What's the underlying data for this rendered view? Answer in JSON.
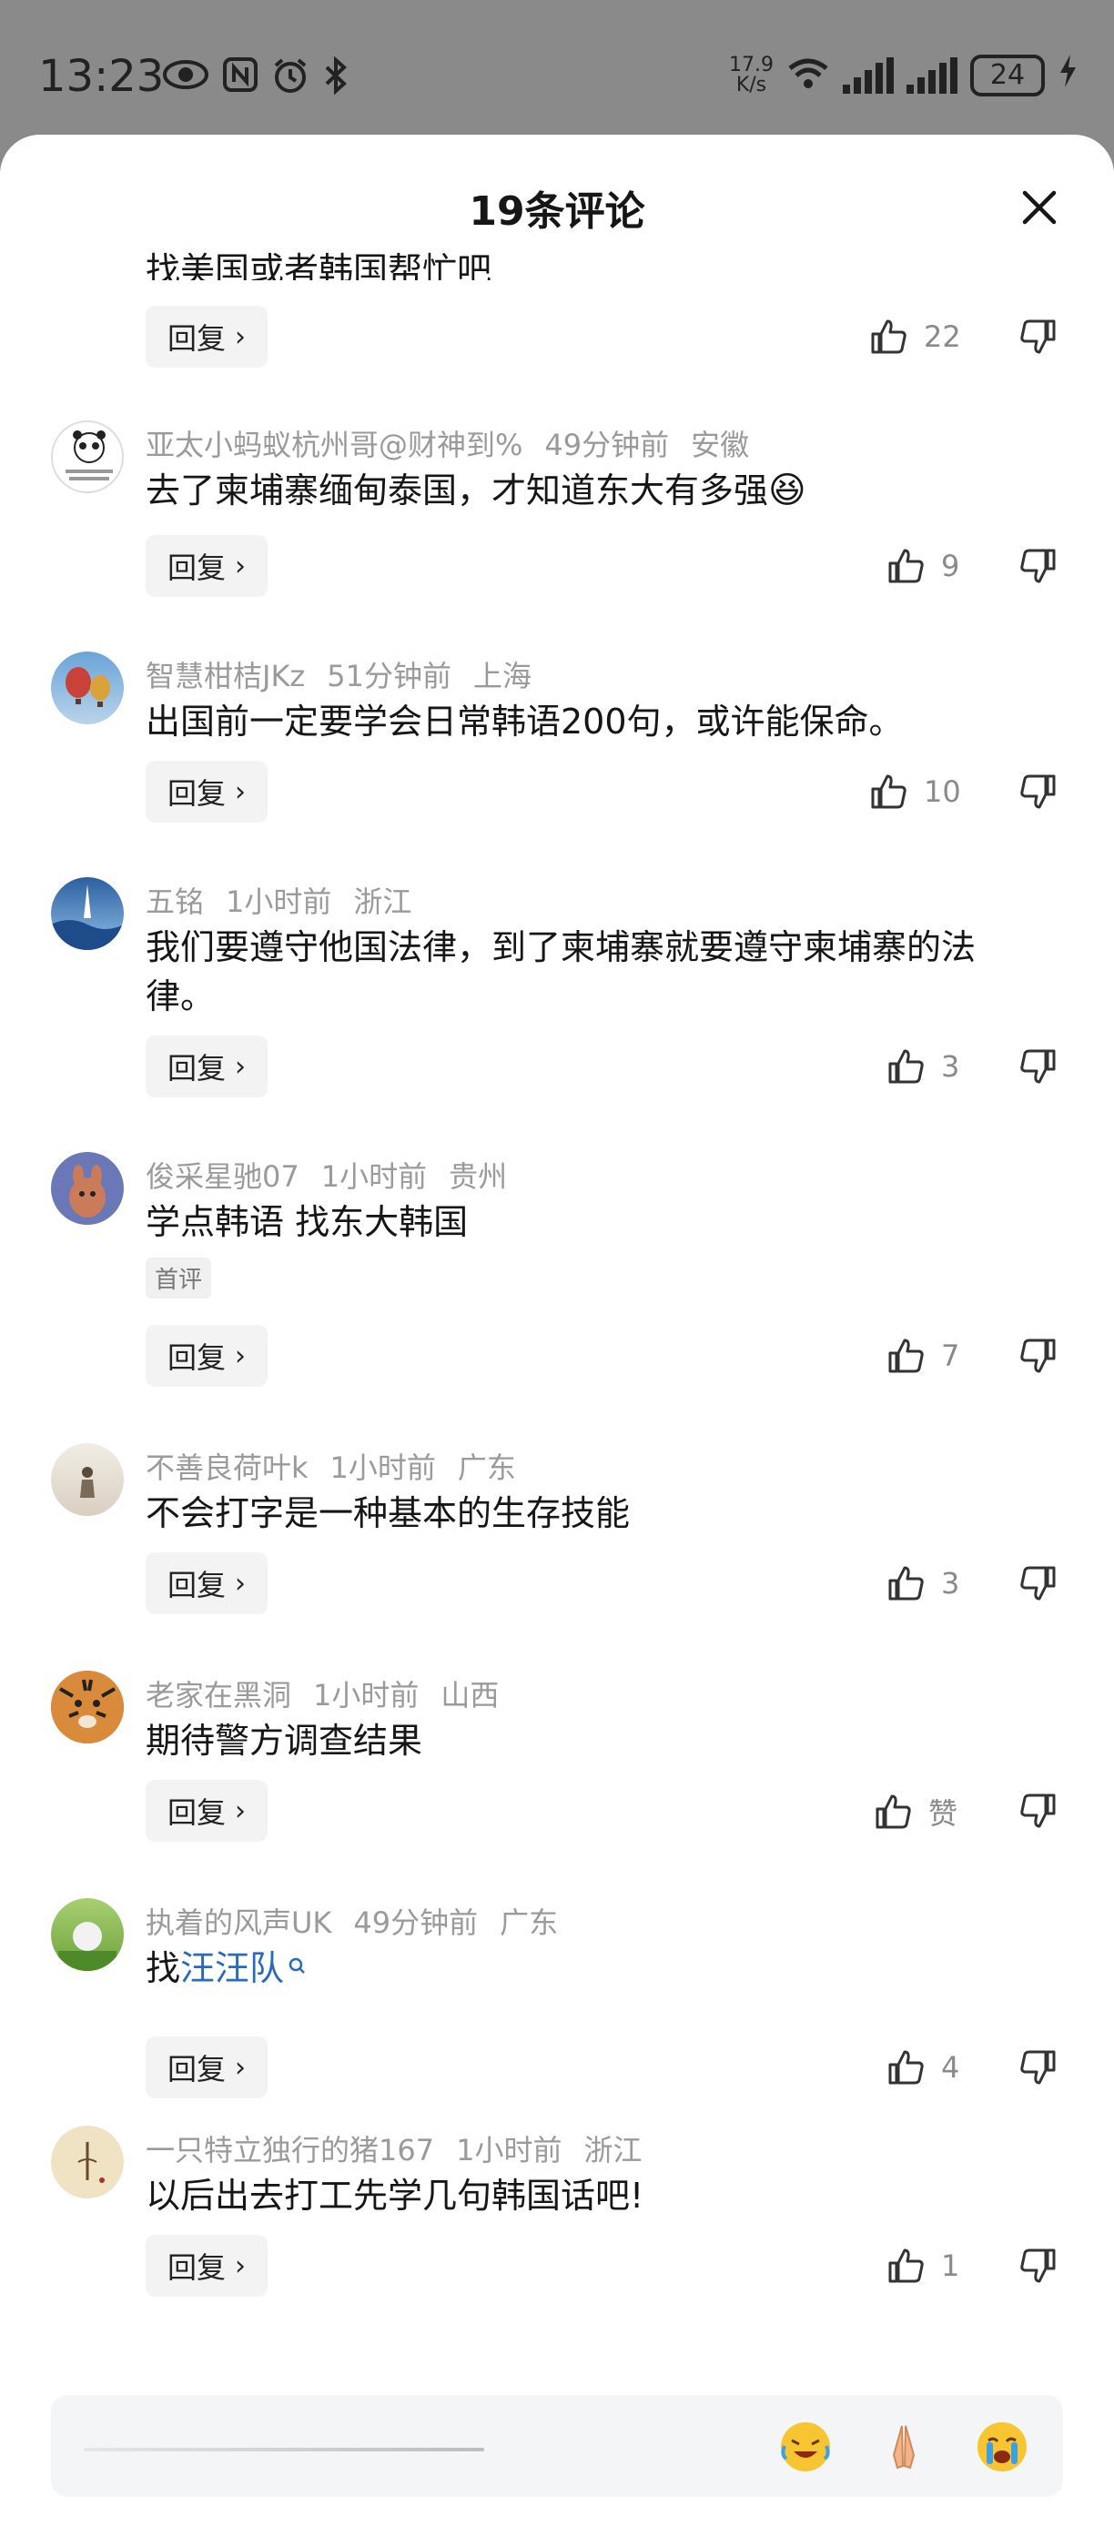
{
  "status": {
    "time": "13:23",
    "net_speed_value": "17.9",
    "net_speed_unit": "K/s",
    "battery": "24"
  },
  "sheet": {
    "title": "19条评论"
  },
  "reply_label": "回复",
  "first_badge_label": "首评",
  "comments": [
    {
      "text": "找美国或者韩国帮忙吧",
      "likes": "22"
    },
    {
      "username": "亚太小蚂蚁杭州哥@财神到%",
      "time": "49分钟前",
      "location": "安徽",
      "text": "去了柬埔寨缅甸泰国，才知道东大有多强",
      "text_emoji": "😆",
      "likes": "9"
    },
    {
      "username": "智慧柑桔JKz",
      "time": "51分钟前",
      "location": "上海",
      "text": "出国前一定要学会日常韩语200句，或许能保命。",
      "likes": "10"
    },
    {
      "username": "五铭",
      "time": "1小时前",
      "location": "浙江",
      "text": "我们要遵守他国法律，到了柬埔寨就要遵守柬埔寨的法律。",
      "likes": "3"
    },
    {
      "username": "俊采星驰07",
      "time": "1小时前",
      "location": "贵州",
      "text": "学点韩语 找东大韩国",
      "badge": "首评",
      "likes": "7"
    },
    {
      "username": "不善良荷叶k",
      "time": "1小时前",
      "location": "广东",
      "text": "不会打字是一种基本的生存技能",
      "likes": "3"
    },
    {
      "username": "老家在黑洞",
      "time": "1小时前",
      "location": "山西",
      "text": "期待警方调查结果",
      "likes": "赞"
    },
    {
      "username": "执着的风声UK",
      "time": "49分钟前",
      "location": "广东",
      "text_prefix": "找",
      "text_link": "汪汪队",
      "likes": "4"
    },
    {
      "username": "一只特立独行的猪167",
      "time": "1小时前",
      "location": "浙江",
      "text": "以后出去打工先学几句韩国话吧!",
      "likes": "1"
    }
  ],
  "input": {
    "emojis": [
      "laughing-crying-emoji",
      "praying-hands-emoji",
      "crying-emoji"
    ]
  },
  "colors": {
    "link": "#2a6bb8",
    "meta_text": "#9a9a9a",
    "body_text": "#161616",
    "overlay": "#8a8a8a"
  }
}
